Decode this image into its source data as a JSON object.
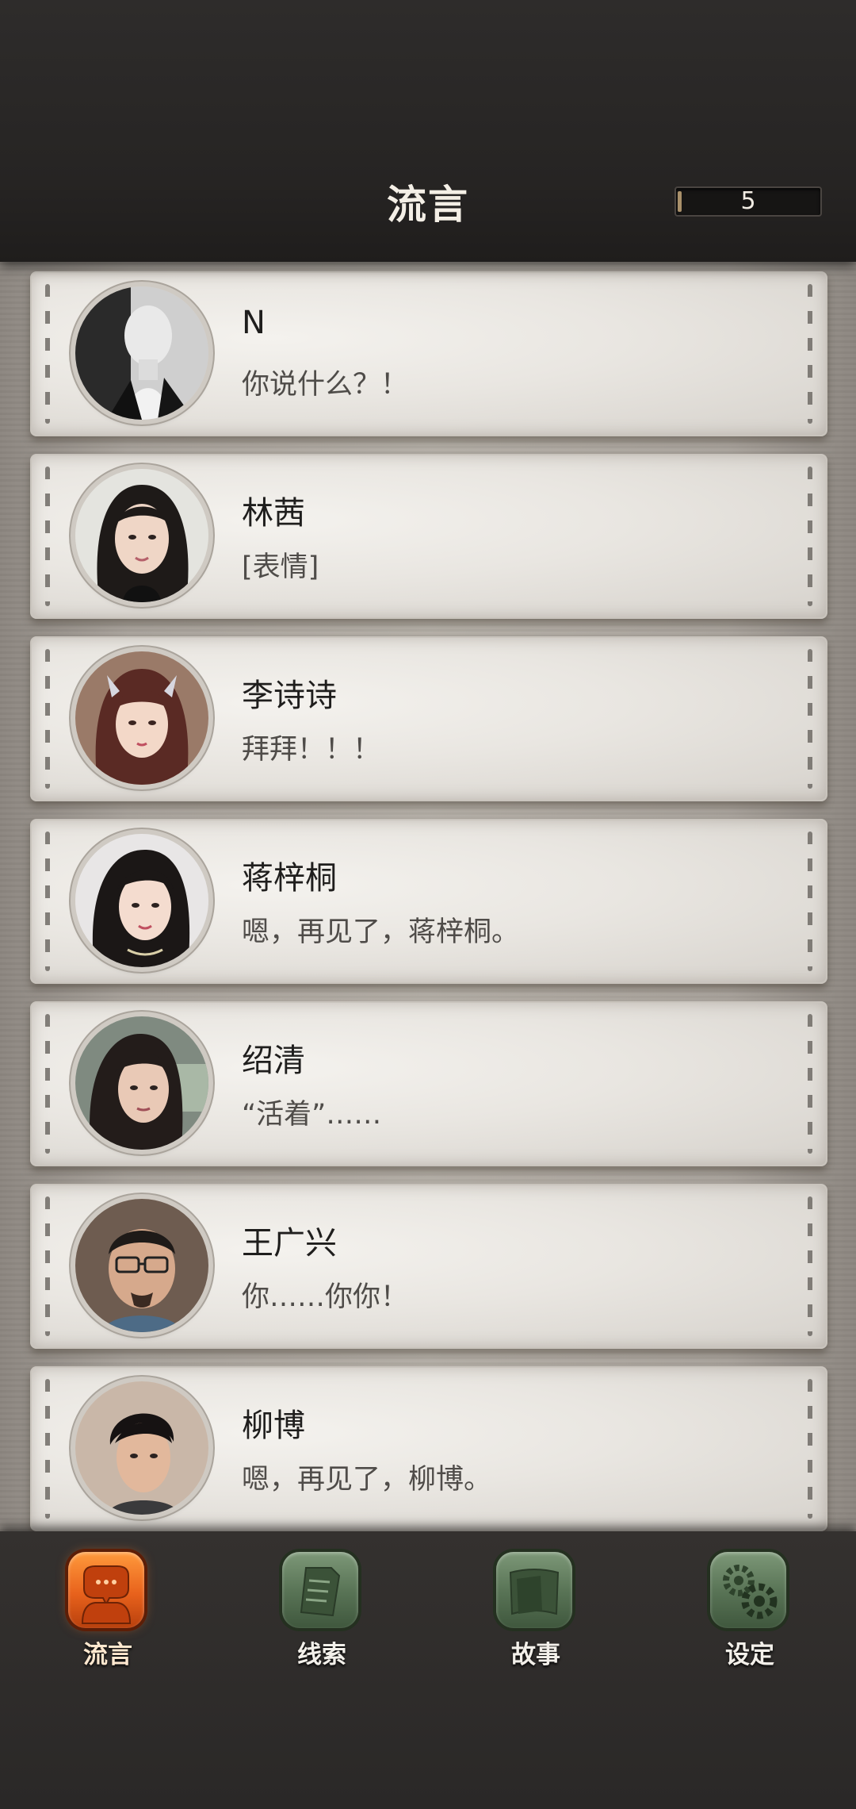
{
  "header": {
    "title": "流言",
    "counter": "5"
  },
  "contacts": [
    {
      "name": "N",
      "message": "你说什么？！",
      "avatar": "avatar-n"
    },
    {
      "name": "林茜",
      "message": "[表情]",
      "avatar": "avatar-linxi"
    },
    {
      "name": "李诗诗",
      "message": "拜拜！！！",
      "avatar": "avatar-lishishi"
    },
    {
      "name": "蒋梓桐",
      "message": "嗯，再见了，蒋梓桐。",
      "avatar": "avatar-jiangzitong"
    },
    {
      "name": "绍清",
      "message": "“活着”……",
      "avatar": "avatar-shaoqing"
    },
    {
      "name": "王广兴",
      "message": "你……你你！",
      "avatar": "avatar-wangguangxing"
    },
    {
      "name": "柳博",
      "message": "嗯，再见了，柳博。",
      "avatar": "avatar-liubo"
    }
  ],
  "nav": [
    {
      "label": "流言",
      "icon": "chat-bubble-icon",
      "active": true
    },
    {
      "label": "线索",
      "icon": "document-icon",
      "active": false
    },
    {
      "label": "故事",
      "icon": "book-icon",
      "active": false
    },
    {
      "label": "设定",
      "icon": "gear-icon",
      "active": false
    }
  ],
  "colors": {
    "accent": "#e8621c",
    "inactive_tab": "#5a7557"
  }
}
